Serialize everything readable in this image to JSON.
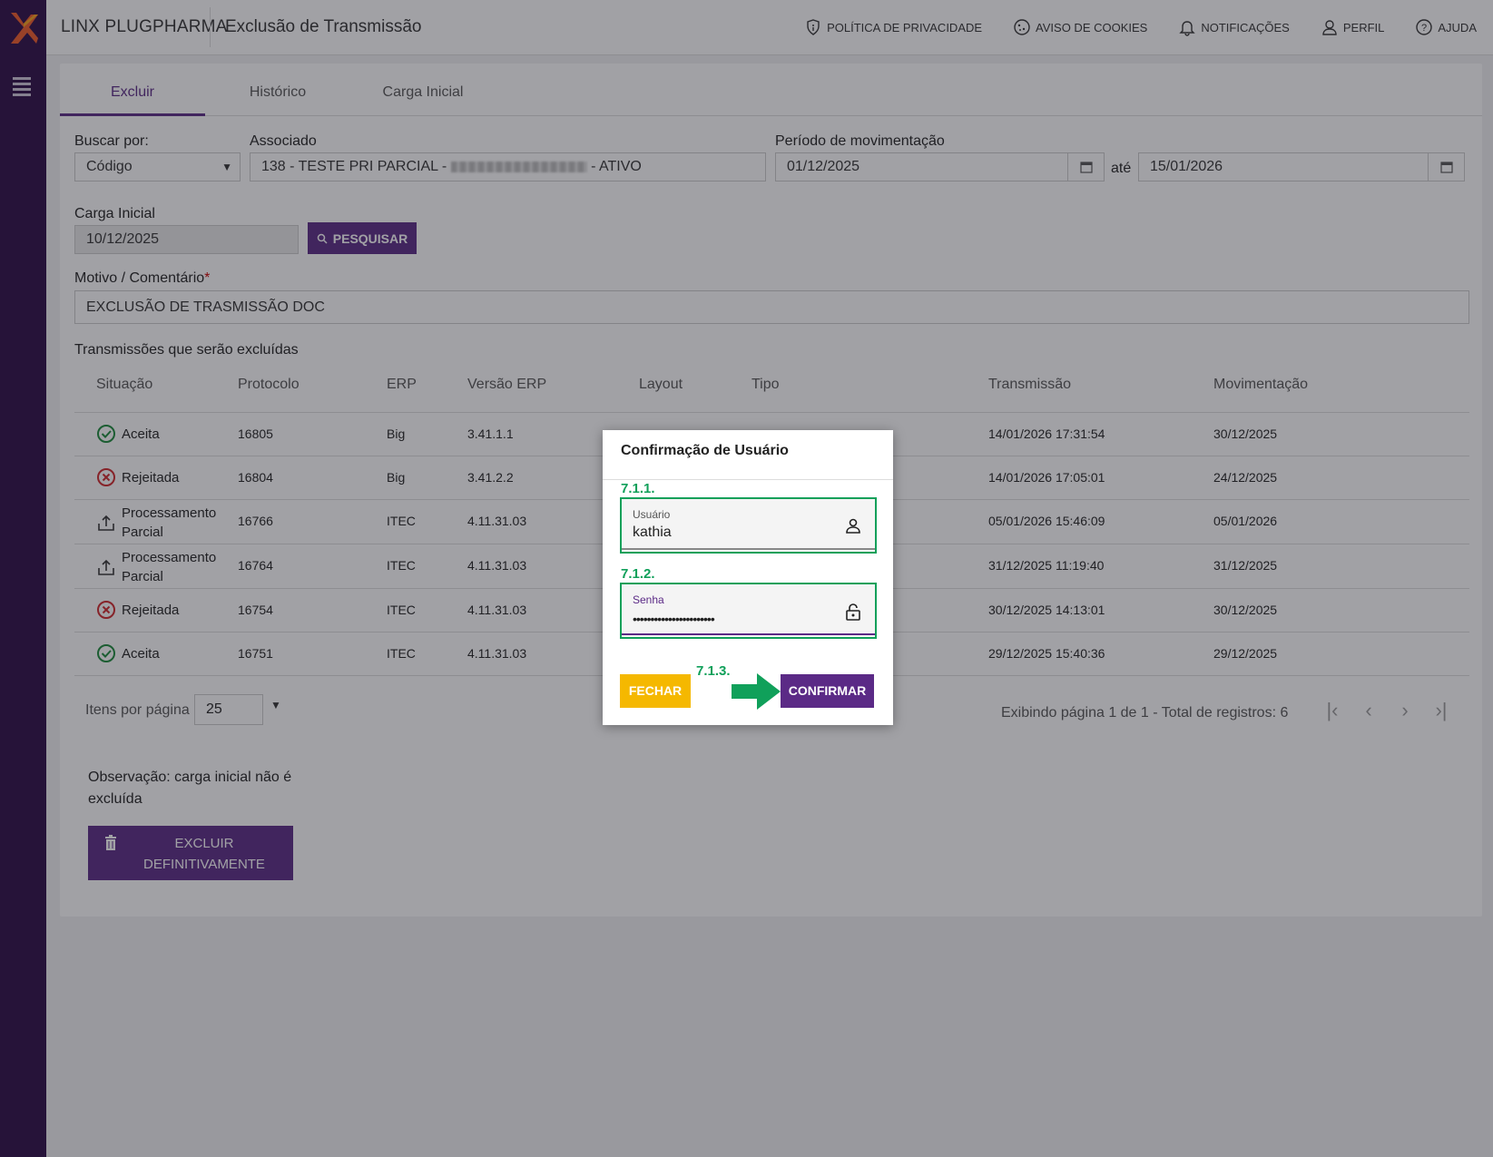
{
  "header": {
    "brand": "LINX PLUGPHARMA",
    "title": "Exclusão de Transmissão",
    "nav": [
      {
        "label": "POLÍTICA DE PRIVACIDADE",
        "icon": "shield-icon"
      },
      {
        "label": "AVISO DE COOKIES",
        "icon": "cookie-icon"
      },
      {
        "label": "NOTIFICAÇÕES",
        "icon": "bell-icon"
      },
      {
        "label": "PERFIL",
        "icon": "user-icon"
      },
      {
        "label": "AJUDA",
        "icon": "help-icon"
      }
    ]
  },
  "tabs": [
    "Excluir",
    "Histórico",
    "Carga Inicial"
  ],
  "form": {
    "buscar_label": "Buscar por:",
    "buscar_value": "Código",
    "associado_label": "Associado",
    "associado_prefix": "138 - TESTE PRI PARCIAL - ",
    "associado_suffix": " - ATIVO",
    "periodo_label": "Período de movimentação",
    "periodo_inicio": "01/12/2025",
    "ate_label": "até",
    "periodo_fim": "15/01/2026",
    "carga_label": "Carga Inicial",
    "carga_value": "10/12/2025",
    "pesquisar_label": "PESQUISAR",
    "motivo_label": "Motivo / Comentário",
    "motivo_required": "*",
    "motivo_value": "EXCLUSÃO DE TRASMISSÃO DOC"
  },
  "table": {
    "caption": "Transmissões que serão excluídas",
    "headers": [
      "Situação",
      "Protocolo",
      "ERP",
      "Versão ERP",
      "Layout",
      "Tipo",
      "Transmissão",
      "Movimentação"
    ],
    "rows": [
      {
        "status": "Aceita",
        "status_line2": "",
        "icon": "check-circle-icon",
        "protocolo": "16805",
        "erp": "Big",
        "versao": "3.41.1.1",
        "transmissao": "14/01/2026 17:31:54",
        "movimentacao": "30/12/2025"
      },
      {
        "status": "Rejeitada",
        "status_line2": "",
        "icon": "x-circle-icon",
        "protocolo": "16804",
        "erp": "Big",
        "versao": "3.41.2.2",
        "transmissao": "14/01/2026 17:05:01",
        "movimentacao": "24/12/2025"
      },
      {
        "status": "Processamento",
        "status_line2": "Parcial",
        "icon": "upload-icon",
        "protocolo": "16766",
        "erp": "ITEC",
        "versao": "4.11.31.03",
        "transmissao": "05/01/2026 15:46:09",
        "movimentacao": "05/01/2026"
      },
      {
        "status": "Processamento",
        "status_line2": "Parcial",
        "icon": "upload-icon",
        "protocolo": "16764",
        "erp": "ITEC",
        "versao": "4.11.31.03",
        "transmissao": "31/12/2025 11:19:40",
        "movimentacao": "31/12/2025"
      },
      {
        "status": "Rejeitada",
        "status_line2": "",
        "icon": "x-circle-icon",
        "protocolo": "16754",
        "erp": "ITEC",
        "versao": "4.11.31.03",
        "transmissao": "30/12/2025 14:13:01",
        "movimentacao": "30/12/2025"
      },
      {
        "status": "Aceita",
        "status_line2": "",
        "icon": "check-circle-icon",
        "protocolo": "16751",
        "erp": "ITEC",
        "versao": "4.11.31.03",
        "transmissao": "29/12/2025 15:40:36",
        "movimentacao": "29/12/2025"
      }
    ]
  },
  "pager": {
    "itens_label": "Itens por página",
    "itens_value": "25",
    "info": "Exibindo página 1 de 1 - Total de registros: 6"
  },
  "obs": "Observação: carga inicial não é excluída",
  "excluir_label_1": "EXCLUIR",
  "excluir_label_2": "DEFINITIVAMENTE",
  "modal": {
    "title": "Confirmação de Usuário",
    "step1": "7.1.1.",
    "usuario_label": "Usuário",
    "usuario_value": "kathia",
    "step2": "7.1.2.",
    "senha_label": "Senha",
    "senha_value": "•••••••••••••••••••••••",
    "step3": "7.1.3.",
    "fechar_label": "FECHAR",
    "confirmar_label": "CONFIRMAR"
  },
  "colors": {
    "primary": "#5b2a86",
    "accent": "#f5b800",
    "highlight": "#10a05a",
    "sidebar": "#2b0b45"
  }
}
